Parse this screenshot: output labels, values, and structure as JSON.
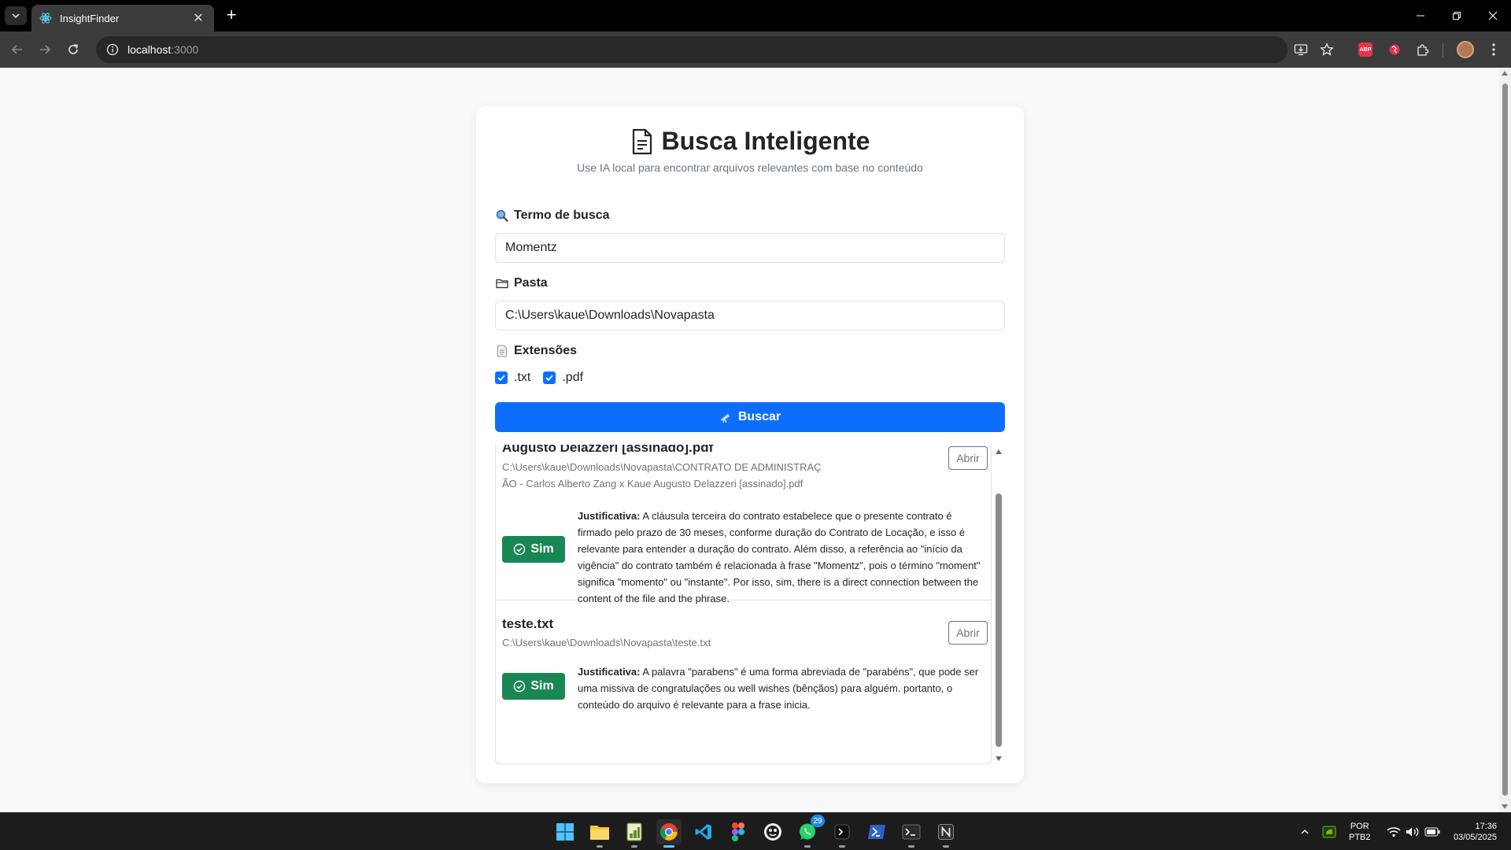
{
  "browser": {
    "tab_title": "InsightFinder",
    "url_host": "localhost",
    "url_port": ":3000"
  },
  "app": {
    "title": "Busca Inteligente",
    "subtitle": "Use IA local para encontrar arquivos relevantes com base no conteúdo",
    "search_label": "Termo de busca",
    "search_value": "Momentz",
    "folder_label": "Pasta",
    "folder_value": "C:\\Users\\kaue\\Downloads\\Novapasta",
    "extensions_label": "Extensões",
    "extensions": [
      {
        "label": ".txt",
        "checked": true
      },
      {
        "label": ".pdf",
        "checked": true
      }
    ],
    "search_button": "Buscar",
    "accent": "#0d6efd",
    "success": "#198754"
  },
  "results": [
    {
      "name": "Augusto Delazzeri [assinado].pdf",
      "path": "C:\\Users\\kaue\\Downloads\\Novapasta\\CONTRATO DE ADMINISTRAÇÃO - Carlos Alberto Zang x Kaue Augusto Delazzeri [assinado].pdf",
      "open_label": "Abrir",
      "verdict": "Sim",
      "justification_label": "Justificativa:",
      "justification": "A cláusula terceira do contrato estabelece que o presente contrato é firmado pelo prazo de 30 meses, conforme duração do Contrato de Locação, e isso é relevante para entender a duração do contrato. Além disso, a referência ao \"início da vigência\" do contrato também é relacionada à frase \"Momentz\", pois o término \"moment\" significa \"momento\" ou \"instante\". Por isso, sim, there is a direct connection between the content of the file and the phrase."
    },
    {
      "name": "teste.txt",
      "path": "C:\\Users\\kaue\\Downloads\\Novapasta\\teste.txt",
      "open_label": "Abrir",
      "verdict": "Sim",
      "justification_label": "Justificativa:",
      "justification": "A palavra \"parabens\" é uma forma abreviada de \"parabéns\", que pode ser uma missiva de congratulações ou well wishes (bênçãos) para alguém. portanto, o conteúdo do arquivo é relevante para a frase inicia."
    }
  ],
  "taskbar": {
    "whatsapp_badge": "29",
    "lang_line1": "POR",
    "lang_line2": "PTB2",
    "time": "17:36",
    "date": "03/05/2025"
  }
}
